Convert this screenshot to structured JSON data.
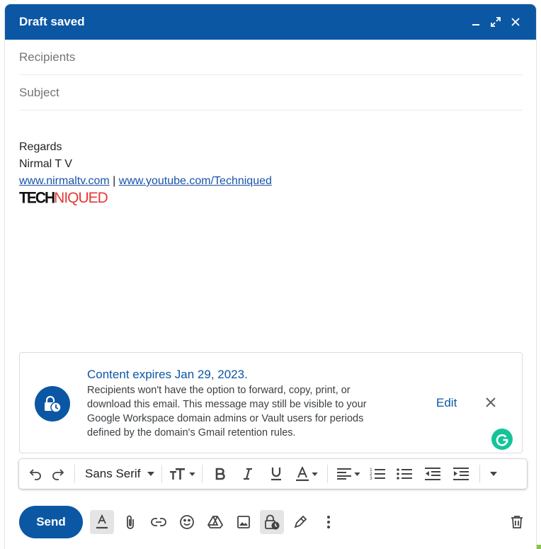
{
  "header": {
    "title": "Draft saved"
  },
  "fields": {
    "recipients_placeholder": "Recipients",
    "subject_placeholder": "Subject"
  },
  "signature": {
    "line1": "Regards",
    "line2": "Nirmal T V",
    "link1": "www.nirmaltv.com",
    "separator": " | ",
    "link2": "www.youtube.com/Techniqued",
    "logo_part1": "TECH",
    "logo_part2": "NIQUED"
  },
  "notice": {
    "title": "Content expires Jan 29, 2023.",
    "text": "Recipients won't have the option to forward, copy, print, or download this email. This message may still be visible to your Google Workspace domain admins or Vault users for periods defined by the domain's Gmail retention rules.",
    "edit_label": "Edit"
  },
  "format_bar": {
    "font": "Sans Serif"
  },
  "bottom_bar": {
    "send_label": "Send"
  },
  "colors": {
    "brand": "#0b57a4",
    "grammarly": "#15c39a",
    "logo_red": "#e53935"
  }
}
